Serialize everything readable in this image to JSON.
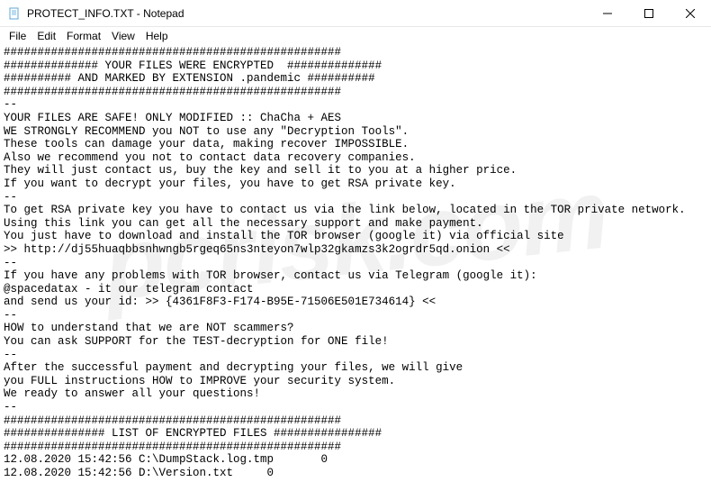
{
  "window": {
    "title": "PROTECT_INFO.TXT - Notepad"
  },
  "menu": {
    "file": "File",
    "edit": "Edit",
    "format": "Format",
    "view": "View",
    "help": "Help"
  },
  "body_text": "##################################################\n############## YOUR FILES WERE ENCRYPTED  ##############\n########## AND MARKED BY EXTENSION .pandemic ##########\n##################################################\n--\nYOUR FILES ARE SAFE! ONLY MODIFIED :: ChaCha + AES\nWE STRONGLY RECOMMEND you NOT to use any \"Decryption Tools\".\nThese tools can damage your data, making recover IMPOSSIBLE.\nAlso we recommend you not to contact data recovery companies.\nThey will just contact us, buy the key and sell it to you at a higher price.\nIf you want to decrypt your files, you have to get RSA private key.\n--\nTo get RSA private key you have to contact us via the link below, located in the TOR private network.\nUsing this link you can get all the necessary support and make payment.\nYou just have to download and install the TOR browser (google it) via official site\n>> http://dj55huaqbbsnhwngb5rgeq65ns3nteyon7wlp32gkamzs3k2ogrdr5qd.onion <<\n--\nIf you have any problems with TOR browser, contact us via Telegram (google it):\n@spacedatax - it our telegram contact\nand send us your id: >> {4361F8F3-F174-B95E-71506E501E734614} <<\n--\nHOW to understand that we are NOT scammers?\nYou can ask SUPPORT for the TEST-decryption for ONE file!\n--\nAfter the successful payment and decrypting your files, we will give\nyou FULL instructions HOW to IMPROVE your security system.\nWe ready to answer all your questions!\n--\n##################################################\n############### LIST OF ENCRYPTED FILES ################\n##################################################\n12.08.2020 15:42:56 C:\\DumpStack.log.tmp       0\n12.08.2020 15:42:56 D:\\Version.txt     0",
  "watermark": "pcrisk.com"
}
